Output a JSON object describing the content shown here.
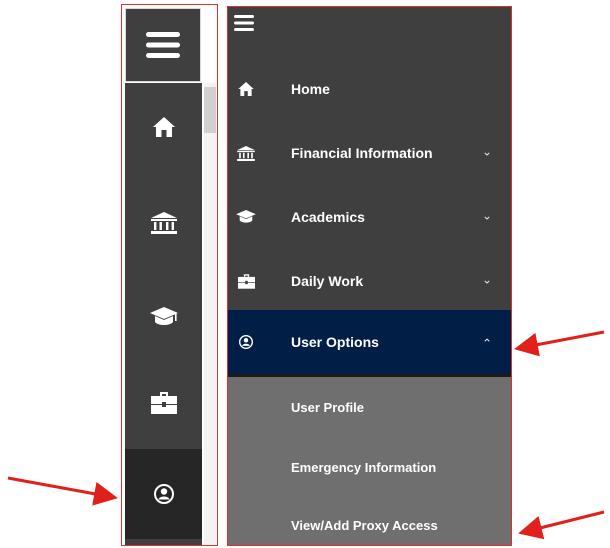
{
  "rail": {
    "icons": [
      "menu-icon",
      "home-icon",
      "bank-icon",
      "graduation-cap-icon",
      "briefcase-icon",
      "user-icon"
    ]
  },
  "menu": {
    "items": [
      {
        "label": "Home",
        "icon": "home-icon",
        "has_chevron": false
      },
      {
        "label": "Financial Information",
        "icon": "bank-icon",
        "has_chevron": true
      },
      {
        "label": "Academics",
        "icon": "graduation-cap-icon",
        "has_chevron": true
      },
      {
        "label": "Daily Work",
        "icon": "briefcase-icon",
        "has_chevron": true
      },
      {
        "label": "User Options",
        "icon": "user-icon",
        "has_chevron": true,
        "expanded": true
      }
    ],
    "submenu": [
      "User Profile",
      "Emergency Information",
      "View/Add Proxy Access"
    ]
  },
  "colors": {
    "sidebar_bg": "#3f3f3f",
    "active_bg": "#011e46",
    "submenu_bg": "#6f6f6f",
    "annotation": "#e0201b"
  }
}
